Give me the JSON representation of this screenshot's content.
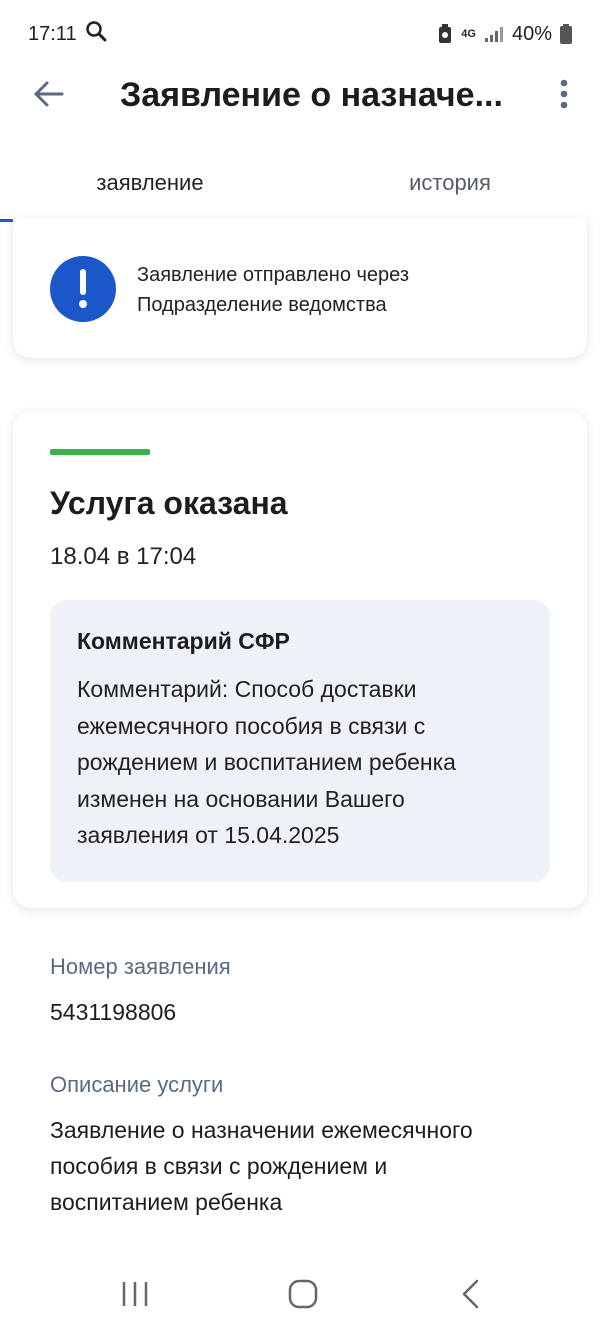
{
  "status_bar": {
    "time": "17:11",
    "network": "4G",
    "battery": "40%",
    "icons": [
      "search-icon",
      "battery-saver-icon",
      "signal-icon",
      "battery-icon"
    ]
  },
  "header": {
    "title": "Заявление о назначе...",
    "back_icon": "arrow-left-icon",
    "menu_icon": "more-vertical-icon"
  },
  "tabs": [
    {
      "label": "заявление",
      "active": true
    },
    {
      "label": "история",
      "active": false
    }
  ],
  "notice": {
    "icon": "exclamation-icon",
    "line1": "Заявление отправлено через",
    "line2": "Подразделение ведомства"
  },
  "status_card": {
    "stripe_color": "#37b44a",
    "title": "Услуга оказана",
    "date": "18.04 в 17:04",
    "comment": {
      "title": "Комментарий СФР",
      "lines": [
        "Комментарий: Способ доставки",
        "ежемесячного пособия в связи с",
        "рождением и воспитанием ребенка",
        "изменен на основании Вашего",
        "заявления от 15.04.2025"
      ]
    }
  },
  "details": {
    "number_label": "Номер заявления",
    "number_value": "5431198806",
    "description_label": "Описание услуги",
    "description_lines": [
      "Заявление о назначении ежемесячного",
      "пособия в связи с рождением и",
      "воспитанием ребенка"
    ]
  },
  "nav_bar": {
    "icons": [
      "recent-apps-icon",
      "home-icon",
      "back-icon"
    ]
  },
  "colors": {
    "accent": "#1463c4",
    "notice_icon_bg": "#1c57c9",
    "success": "#37b44a",
    "comment_bg": "#eef2f8",
    "label": "#5b6a82"
  }
}
